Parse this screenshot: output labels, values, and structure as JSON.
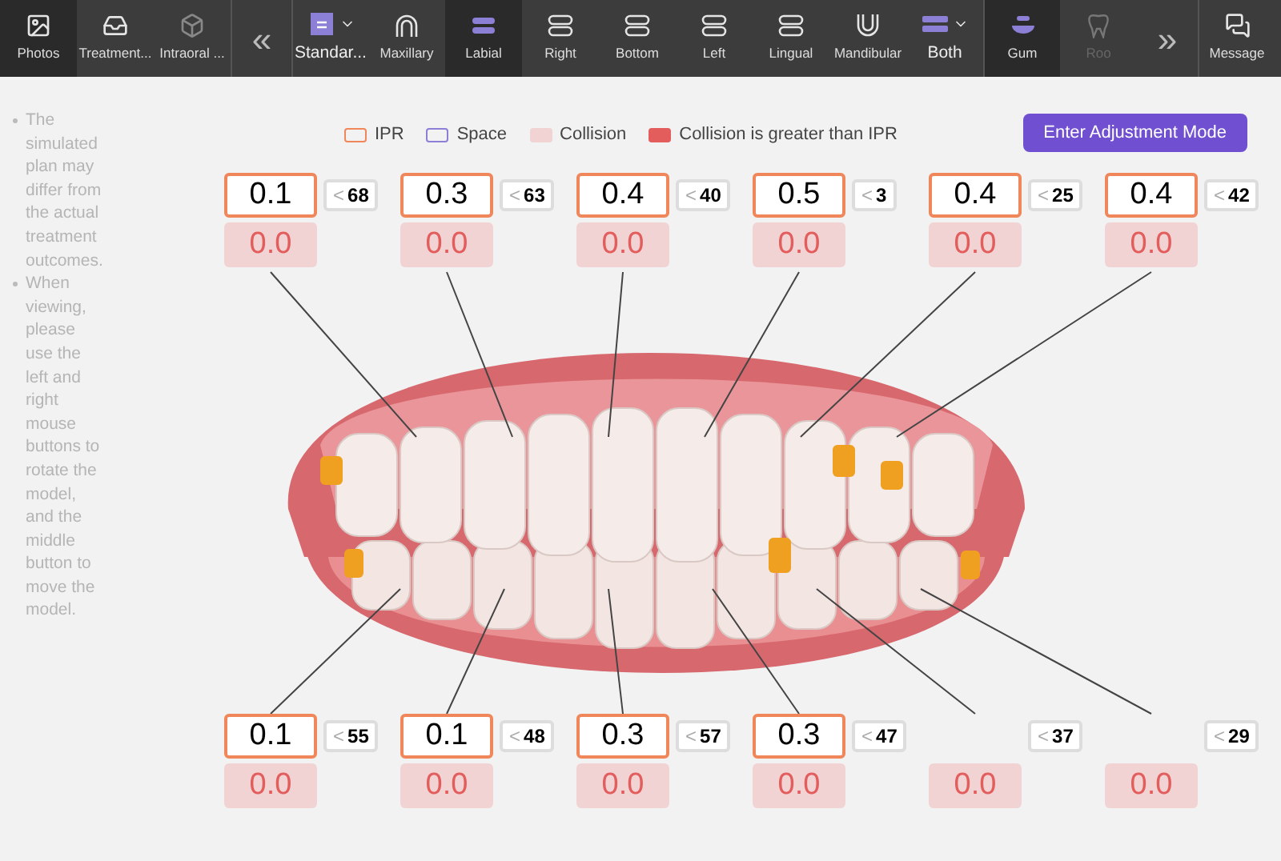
{
  "toolbar": {
    "items": [
      {
        "kind": "tool",
        "label": "Photos",
        "selected": true,
        "disabled": false
      },
      {
        "kind": "tool",
        "label": "Treatment...",
        "selected": false,
        "disabled": false
      },
      {
        "kind": "tool",
        "label": "Intraoral ...",
        "selected": false,
        "disabled": false
      },
      {
        "kind": "collapse",
        "label": "«",
        "selected": false,
        "disabled": false
      },
      {
        "kind": "dropdown",
        "label": "Standar...",
        "selected": false,
        "disabled": false
      },
      {
        "kind": "tool",
        "label": "Maxillary",
        "selected": false,
        "disabled": false
      },
      {
        "kind": "tool",
        "label": "Labial",
        "selected": true,
        "disabled": false
      },
      {
        "kind": "tool",
        "label": "Right",
        "selected": false,
        "disabled": false
      },
      {
        "kind": "tool",
        "label": "Bottom",
        "selected": false,
        "disabled": false
      },
      {
        "kind": "tool",
        "label": "Left",
        "selected": false,
        "disabled": false
      },
      {
        "kind": "tool",
        "label": "Lingual",
        "selected": false,
        "disabled": false
      },
      {
        "kind": "tool",
        "label": "Mandibular",
        "selected": false,
        "disabled": false
      },
      {
        "kind": "dropdown",
        "label": "Both",
        "selected": false,
        "disabled": false
      },
      {
        "kind": "tool",
        "label": "Gum",
        "selected": true,
        "disabled": false
      },
      {
        "kind": "tool",
        "label": "Roo",
        "selected": false,
        "disabled": true
      },
      {
        "kind": "collapse",
        "label": "»",
        "selected": false,
        "disabled": false
      },
      {
        "kind": "tool",
        "label": "Message",
        "selected": false,
        "disabled": false
      }
    ]
  },
  "notes": [
    "The simulated plan may differ from the actual treatment outcomes.",
    "When viewing, please use the left and right mouse buttons to rotate the model, and the middle button to move the model."
  ],
  "adjust_button": "Enter Adjustment Mode",
  "legend": [
    {
      "label": "IPR",
      "kind": "outline",
      "color": "#f0875a"
    },
    {
      "label": "Space",
      "kind": "outline",
      "color": "#8b7fd6"
    },
    {
      "label": "Collision",
      "kind": "fill",
      "color": "#f2d3d4"
    },
    {
      "label": "Collision is greater than IPR",
      "kind": "fill",
      "color": "#e35d5d"
    }
  ],
  "upper_labels": [
    {
      "ipr": "0.1",
      "collision": "0.0",
      "tooth_prefix": "<",
      "tooth": "68"
    },
    {
      "ipr": "0.3",
      "collision": "0.0",
      "tooth_prefix": "<",
      "tooth": "63"
    },
    {
      "ipr": "0.4",
      "collision": "0.0",
      "tooth_prefix": "<",
      "tooth": "40"
    },
    {
      "ipr": "0.5",
      "collision": "0.0",
      "tooth_prefix": "<",
      "tooth": "3"
    },
    {
      "ipr": "0.4",
      "collision": "0.0",
      "tooth_prefix": "<",
      "tooth": "25"
    },
    {
      "ipr": "0.4",
      "collision": "0.0",
      "tooth_prefix": "<",
      "tooth": "42"
    }
  ],
  "lower_labels": [
    {
      "ipr": "0.1",
      "collision": "0.0",
      "tooth_prefix": "<",
      "tooth": "55"
    },
    {
      "ipr": "0.1",
      "collision": "0.0",
      "tooth_prefix": "<",
      "tooth": "48"
    },
    {
      "ipr": "0.3",
      "collision": "0.0",
      "tooth_prefix": "<",
      "tooth": "57"
    },
    {
      "ipr": "0.3",
      "collision": "0.0",
      "tooth_prefix": "<",
      "tooth": "47"
    },
    {
      "collision": "0.0",
      "tooth_prefix": "<",
      "tooth": "37"
    },
    {
      "collision": "0.0",
      "tooth_prefix": "<",
      "tooth": "29"
    }
  ]
}
